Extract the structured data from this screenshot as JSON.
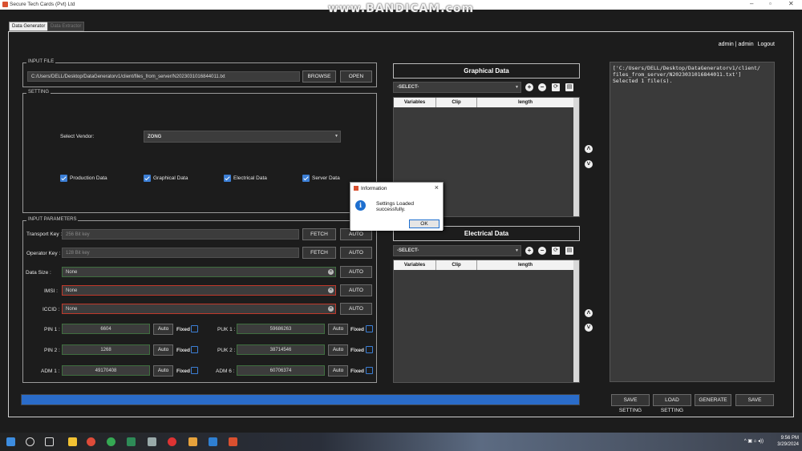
{
  "window": {
    "title": "Secure Tech Cards (Pvt) Ltd",
    "watermark": "www.BANDICAM.com",
    "minimize": "–",
    "maximize": "▫",
    "close": "✕"
  },
  "tabs": [
    {
      "label": "Data Generator",
      "active": true
    },
    {
      "label": "Data Extractor",
      "active": false
    }
  ],
  "user": {
    "name": "admin",
    "role": "admin",
    "logout": "Logout"
  },
  "input_file": {
    "group_title": "INPUT FILE",
    "path": "C:/Users/DELL/Desktop/DataGeneratorv1/client/files_from_server/N2023031016844011.txt",
    "browse": "BROWSE",
    "open": "OPEN"
  },
  "setting": {
    "group_title": "SETTING",
    "vendor_label": "Select Vendor:",
    "vendor_value": "ZONG",
    "checkboxes": [
      "Production Data",
      "Graphical Data",
      "Electrical Data",
      "Server Data"
    ]
  },
  "input_params": {
    "group_title": "INPUT PARAMETERS",
    "transport_label": "Transport Key :",
    "transport_placeholder": "256 Bit key",
    "operator_label": "Operator Key :",
    "operator_placeholder": "128 Bit key",
    "fetch": "FETCH",
    "auto": "AUTO",
    "data_size_label": "Data Size :",
    "data_size_value": "None",
    "imsi_label": "IMSI :",
    "imsi_value": "None",
    "iccid_label": "ICCID :",
    "iccid_value": "None",
    "pins": [
      {
        "label": "PIN 1 :",
        "value": "6604"
      },
      {
        "label": "PIN 2 :",
        "value": "1268"
      },
      {
        "label": "ADM 1 :",
        "value": "49170408"
      }
    ],
    "puks": [
      {
        "label": "PUK 1 :",
        "value": "59686263"
      },
      {
        "label": "PUK 2 :",
        "value": "38714546"
      },
      {
        "label": "ADM 6 :",
        "value": "60706374"
      }
    ],
    "auto_small": "Auto",
    "fixed": "Fixed"
  },
  "graphical": {
    "title": "Graphical Data",
    "select": "-SELECT-",
    "columns": [
      "Variables",
      "Clip",
      "length"
    ]
  },
  "electrical": {
    "title": "Electrical Data",
    "select": "-SELECT-",
    "columns": [
      "Variables",
      "Clip",
      "length"
    ]
  },
  "log": {
    "text": "['C:/Users/DELL/Desktop/DataGeneratorv1/client/\nfiles_from_server/N2023031016844011.txt']\nSelected 1 file(s)."
  },
  "bottom_buttons": {
    "save_setting": "SAVE SETTING",
    "load_setting": "LOAD SETTING",
    "generate": "GENERATE",
    "save": "SAVE"
  },
  "progress": {
    "fraction": 1.0
  },
  "dialog": {
    "title": "Information",
    "message": "Settings Loaded successfully.",
    "ok": "OK"
  },
  "taskbar": {
    "time": "9:56 PM",
    "date": "3/29/2024",
    "tray_icons": "^ ▣ ⌂ ◂))"
  },
  "colors": {
    "accent": "#2a6cc9",
    "error_border": "#c0392b",
    "ok_border": "#3f6e3f"
  }
}
